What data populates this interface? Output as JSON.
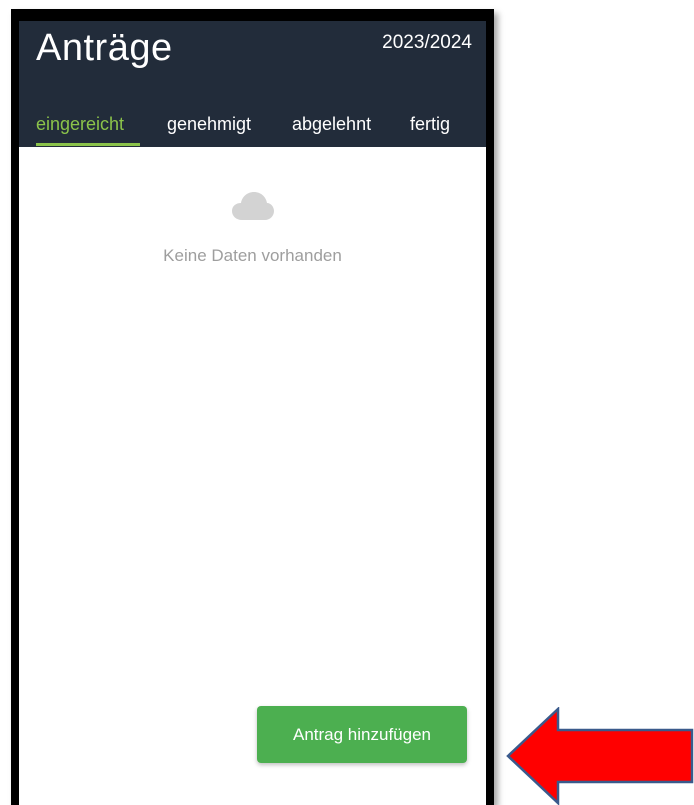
{
  "header": {
    "title": "Anträge",
    "school_year": "2023/2024"
  },
  "tabs": [
    {
      "label": "eingereicht",
      "active": true
    },
    {
      "label": "genehmigt",
      "active": false
    },
    {
      "label": "abgelehnt",
      "active": false
    },
    {
      "label": "fertig",
      "active": false
    }
  ],
  "empty_state": {
    "icon": "cloud-icon",
    "text": "Keine Daten vorhanden"
  },
  "actions": {
    "add_request_label": "Antrag hinzufügen"
  },
  "colors": {
    "header_bg": "#222c3a",
    "accent_green": "#8bc34a",
    "button_green": "#4caf50",
    "annotation_arrow": "#ff0000"
  }
}
